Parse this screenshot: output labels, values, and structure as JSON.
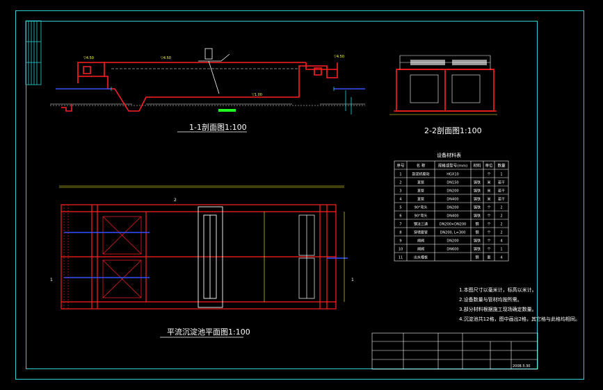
{
  "drawing": {
    "section_1_title": "1-1剖面图1:100",
    "section_2_title": "2-2剖面图1:100",
    "plan_title": "平流沉淀池平面图1:100",
    "table_title": "设备材料表",
    "side_mark_left": "1",
    "side_mark_right": "1",
    "top_mark_2": "2"
  },
  "table": {
    "headers": [
      "序号",
      "名 称",
      "规格或型号(mm)",
      "材料",
      "单位",
      "数量"
    ],
    "rows": [
      [
        "1",
        "刮泥机驱动",
        "HGX10",
        "",
        "个",
        "1"
      ],
      [
        "2",
        "直管",
        "DN150",
        "铸铁",
        "米",
        "若干"
      ],
      [
        "3",
        "直管",
        "DN200",
        "铸铁",
        "米",
        "若干"
      ],
      [
        "4",
        "直管",
        "DN400",
        "铸铁",
        "米",
        "若干"
      ],
      [
        "5",
        "90°弯头",
        "DN200",
        "铸铁",
        "个",
        "2"
      ],
      [
        "6",
        "90°弯头",
        "DN400",
        "铸铁",
        "个",
        "2"
      ],
      [
        "7",
        "钢法三通",
        "DN200×DN200",
        "钢",
        "个",
        "2"
      ],
      [
        "8",
        "穿墙套管",
        "DN200, L=300",
        "钢",
        "个",
        "2"
      ],
      [
        "9",
        "闸阀",
        "DN200",
        "铸铁",
        "个",
        "4"
      ],
      [
        "10",
        "闸阀",
        "DN600",
        "铸铁",
        "个",
        "1"
      ],
      [
        "11",
        "出水堰板",
        "",
        "钢",
        "套",
        "4"
      ]
    ]
  },
  "notes": [
    "1.本图尺寸以毫米计，标高以米计。",
    "2.设备数量与管材均按所需。",
    "3.部分材料根据施工现场确定数量。",
    "4.沉淀池共12格，图中画出2格，其它格与此格均相同。"
  ],
  "title_block": {
    "date": "2008.5.30"
  },
  "colors": {
    "frame": "#2fd0d0",
    "structure": "#ff2020",
    "text": "#ffffff",
    "dimension": "#ffff33",
    "pipe": "#3050ff",
    "green": "#20ff20"
  }
}
